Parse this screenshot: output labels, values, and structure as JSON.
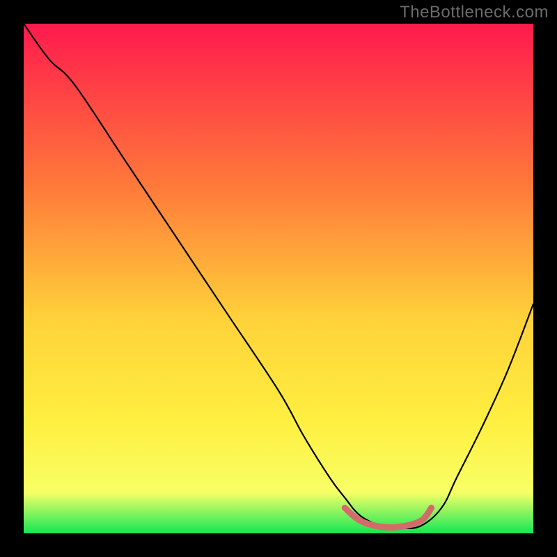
{
  "watermark": "TheBottleneck.com",
  "colors": {
    "background": "#000000",
    "grad_top": "#ff1a4d",
    "grad_mid_high": "#ff7a3a",
    "grad_mid": "#ffd23a",
    "grad_mid_low": "#ffef40",
    "grad_low": "#f7ff66",
    "grad_bottom": "#14e756",
    "curve": "#000000",
    "marker": "#d46a6a"
  },
  "chart_data": {
    "type": "line",
    "title": "",
    "xlabel": "",
    "ylabel": "",
    "xlim": [
      0.0,
      1.0
    ],
    "ylim": [
      0.0,
      1.0
    ],
    "series": [
      {
        "name": "bottleneck-curve",
        "x": [
          0.0,
          0.05,
          0.1,
          0.2,
          0.3,
          0.4,
          0.5,
          0.55,
          0.6,
          0.63,
          0.66,
          0.7,
          0.74,
          0.78,
          0.82,
          0.85,
          0.9,
          0.95,
          1.0
        ],
        "y": [
          1.0,
          0.93,
          0.88,
          0.73,
          0.58,
          0.43,
          0.28,
          0.19,
          0.11,
          0.07,
          0.035,
          0.015,
          0.01,
          0.015,
          0.05,
          0.11,
          0.21,
          0.32,
          0.45
        ]
      },
      {
        "name": "optimal-band",
        "x": [
          0.63,
          0.66,
          0.7,
          0.74,
          0.78,
          0.8
        ],
        "y": [
          0.05,
          0.025,
          0.013,
          0.013,
          0.025,
          0.05
        ]
      }
    ]
  }
}
